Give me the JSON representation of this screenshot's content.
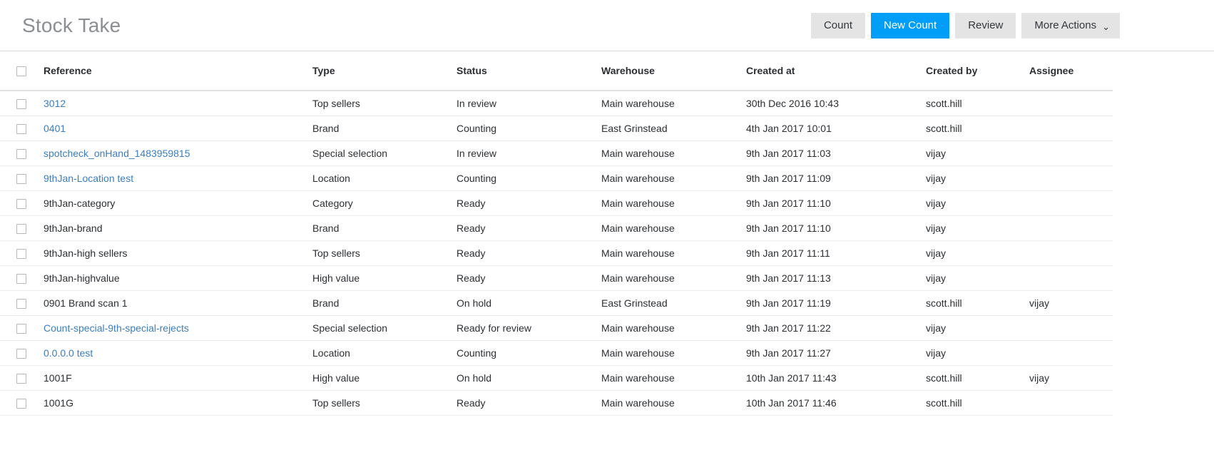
{
  "header": {
    "title": "Stock Take",
    "buttons": [
      {
        "label": "Count",
        "name": "count-button",
        "style": "default"
      },
      {
        "label": "New Count",
        "name": "new-count-button",
        "style": "primary"
      },
      {
        "label": "Review",
        "name": "review-button",
        "style": "default"
      },
      {
        "label": "More Actions",
        "name": "more-actions-button",
        "style": "dropdown",
        "caret": "⌄"
      }
    ]
  },
  "table": {
    "columns": [
      {
        "key": "check",
        "label": ""
      },
      {
        "key": "reference",
        "label": "Reference"
      },
      {
        "key": "type",
        "label": "Type"
      },
      {
        "key": "status",
        "label": "Status"
      },
      {
        "key": "warehouse",
        "label": "Warehouse"
      },
      {
        "key": "created_at",
        "label": "Created at"
      },
      {
        "key": "created_by",
        "label": "Created by"
      },
      {
        "key": "assignee",
        "label": "Assignee"
      }
    ],
    "select_all_checked": false,
    "rows": [
      {
        "reference": "3012",
        "reference_is_link": true,
        "type": "Top sellers",
        "status": "In review",
        "warehouse": "Main warehouse",
        "created_at": "30th Dec 2016 10:43",
        "created_by": "scott.hill",
        "assignee": "",
        "checked": false
      },
      {
        "reference": "0401",
        "reference_is_link": true,
        "type": "Brand",
        "status": "Counting",
        "warehouse": "East Grinstead",
        "created_at": "4th Jan 2017 10:01",
        "created_by": "scott.hill",
        "assignee": "",
        "checked": false
      },
      {
        "reference": "spotcheck_onHand_1483959815",
        "reference_is_link": true,
        "type": "Special selection",
        "status": "In review",
        "warehouse": "Main warehouse",
        "created_at": "9th Jan 2017 11:03",
        "created_by": "vijay",
        "assignee": "",
        "checked": false
      },
      {
        "reference": "9thJan-Location test",
        "reference_is_link": true,
        "type": "Location",
        "status": "Counting",
        "warehouse": "Main warehouse",
        "created_at": "9th Jan 2017 11:09",
        "created_by": "vijay",
        "assignee": "",
        "checked": false
      },
      {
        "reference": "9thJan-category",
        "reference_is_link": false,
        "type": "Category",
        "status": "Ready",
        "warehouse": "Main warehouse",
        "created_at": "9th Jan 2017 11:10",
        "created_by": "vijay",
        "assignee": "",
        "checked": false
      },
      {
        "reference": "9thJan-brand",
        "reference_is_link": false,
        "type": "Brand",
        "status": "Ready",
        "warehouse": "Main warehouse",
        "created_at": "9th Jan 2017 11:10",
        "created_by": "vijay",
        "assignee": "",
        "checked": false
      },
      {
        "reference": "9thJan-high sellers",
        "reference_is_link": false,
        "type": "Top sellers",
        "status": "Ready",
        "warehouse": "Main warehouse",
        "created_at": "9th Jan 2017 11:11",
        "created_by": "vijay",
        "assignee": "",
        "checked": false
      },
      {
        "reference": "9thJan-highvalue",
        "reference_is_link": false,
        "type": "High value",
        "status": "Ready",
        "warehouse": "Main warehouse",
        "created_at": "9th Jan 2017 11:13",
        "created_by": "vijay",
        "assignee": "",
        "checked": false
      },
      {
        "reference": "0901 Brand scan 1",
        "reference_is_link": false,
        "type": "Brand",
        "status": "On hold",
        "warehouse": "East Grinstead",
        "created_at": "9th Jan 2017 11:19",
        "created_by": "scott.hill",
        "assignee": "vijay",
        "checked": false
      },
      {
        "reference": "Count-special-9th-special-rejects",
        "reference_is_link": true,
        "type": "Special selection",
        "status": "Ready for review",
        "warehouse": "Main warehouse",
        "created_at": "9th Jan 2017 11:22",
        "created_by": "vijay",
        "assignee": "",
        "checked": false
      },
      {
        "reference": "0.0.0.0 test",
        "reference_is_link": true,
        "type": "Location",
        "status": "Counting",
        "warehouse": "Main warehouse",
        "created_at": "9th Jan 2017 11:27",
        "created_by": "vijay",
        "assignee": "",
        "checked": false
      },
      {
        "reference": "1001F",
        "reference_is_link": false,
        "type": "High value",
        "status": "On hold",
        "warehouse": "Main warehouse",
        "created_at": "10th Jan 2017 11:43",
        "created_by": "scott.hill",
        "assignee": "vijay",
        "checked": false
      },
      {
        "reference": "1001G",
        "reference_is_link": false,
        "type": "Top sellers",
        "status": "Ready",
        "warehouse": "Main warehouse",
        "created_at": "10th Jan 2017 11:46",
        "created_by": "scott.hill",
        "assignee": "",
        "checked": false
      }
    ]
  },
  "colors": {
    "accent": "#009ef7",
    "link": "#3a7ec0",
    "button_bg": "#e4e4e4",
    "title": "#8b8f94",
    "text": "#2b2f33",
    "row_divider": "#ececec"
  }
}
